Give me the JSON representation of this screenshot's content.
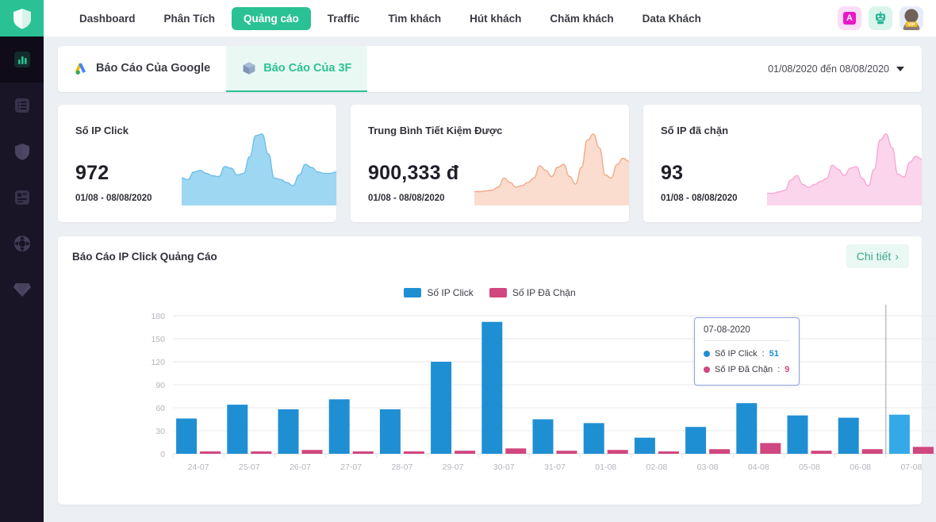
{
  "sidebar": {
    "logo_icon": "shield-logo-icon",
    "items": [
      {
        "icon": "bar-chart-icon",
        "active": true
      },
      {
        "icon": "list-icon",
        "active": false
      },
      {
        "icon": "shield-icon",
        "active": false
      },
      {
        "icon": "layout-icon",
        "active": false
      },
      {
        "icon": "target-icon",
        "active": false
      },
      {
        "icon": "diamond-icon",
        "active": false
      }
    ]
  },
  "topnav": {
    "items": [
      {
        "label": "Dashboard",
        "active": false
      },
      {
        "label": "Phân Tích",
        "active": false
      },
      {
        "label": "Quảng cáo",
        "active": true
      },
      {
        "label": "Traffic",
        "active": false
      },
      {
        "label": "Tìm khách",
        "active": false
      },
      {
        "label": "Hút khách",
        "active": false
      },
      {
        "label": "Chăm khách",
        "active": false
      },
      {
        "label": "Data Khách",
        "active": false
      }
    ],
    "icons": [
      {
        "name": "adobe-a-icon",
        "label": "A"
      },
      {
        "name": "robot-icon",
        "label": ""
      },
      {
        "name": "user-avatar-vip",
        "label": "VIP"
      }
    ]
  },
  "tabs": {
    "items": [
      {
        "label": "Báo Cáo Của Google",
        "icon": "google-ads-icon",
        "active": false
      },
      {
        "label": "Báo Cáo Của 3F",
        "icon": "cube-3f-icon",
        "active": true
      }
    ],
    "date_range": "01/08/2020 đến 08/08/2020"
  },
  "stats": [
    {
      "title": "Số IP Click",
      "value": "972",
      "subtitle": "01/08 - 08/08/2020",
      "color": "#9ed7f2",
      "stroke": "#6fc0e8",
      "spark": [
        30,
        28,
        38,
        40,
        36,
        33,
        32,
        45,
        43,
        34,
        36,
        58,
        86,
        88,
        62,
        30,
        28,
        24,
        20,
        34,
        48,
        44,
        38,
        36,
        36,
        38
      ]
    },
    {
      "title": "Trung Bình Tiết Kiệm Được",
      "value": "900,333 đ",
      "subtitle": "01/08 - 08/08/2020",
      "color": "#fbddcf",
      "stroke": "#f4a98a",
      "spark": [
        12,
        12,
        13,
        14,
        18,
        30,
        24,
        18,
        20,
        24,
        30,
        46,
        40,
        32,
        44,
        48,
        32,
        22,
        44,
        80,
        88,
        70,
        34,
        30,
        48,
        56,
        52
      ]
    },
    {
      "title": "Số IP đã chặn",
      "value": "93",
      "subtitle": "01/08 - 08/08/2020",
      "color": "#fbd5ec",
      "stroke": "#f7a9d6",
      "spark": [
        10,
        10,
        12,
        14,
        28,
        34,
        22,
        18,
        22,
        26,
        30,
        48,
        42,
        34,
        44,
        46,
        30,
        20,
        42,
        82,
        90,
        72,
        36,
        32,
        52,
        60,
        56
      ]
    }
  ],
  "main_chart": {
    "title": "Báo Cáo IP Click Quảng Cáo",
    "detail_label": "Chi tiết",
    "detail_chevron": "›",
    "tooltip": {
      "date": "07-08-2020",
      "rows": [
        {
          "label": "Số IP Click",
          "value": "51",
          "color": "#1f8fd4"
        },
        {
          "label": "Số IP Đã Chặn",
          "value": "9",
          "color": "#d1477f"
        }
      ]
    }
  },
  "chart_data": {
    "type": "bar",
    "title": "Báo Cáo IP Click Quảng Cáo",
    "xlabel": "",
    "ylabel": "",
    "ylim": [
      0,
      180
    ],
    "yticks": [
      0,
      30,
      60,
      90,
      120,
      150,
      180
    ],
    "grid": true,
    "legend_position": "top-center",
    "categories": [
      "24-07",
      "25-07",
      "26-07",
      "27-07",
      "28-07",
      "29-07",
      "30-07",
      "31-07",
      "01-08",
      "02-08",
      "03-08",
      "04-08",
      "05-08",
      "06-08",
      "07-08"
    ],
    "series": [
      {
        "name": "Số IP Click",
        "color": "#1f8fd4",
        "values": [
          46,
          64,
          58,
          71,
          58,
          120,
          172,
          45,
          40,
          21,
          35,
          66,
          50,
          47,
          51
        ]
      },
      {
        "name": "Số IP Đã Chặn",
        "color": "#d1477f",
        "values": [
          3,
          3,
          5,
          3,
          3,
          4,
          7,
          4,
          5,
          2,
          6,
          14,
          4,
          6,
          9
        ]
      }
    ]
  }
}
